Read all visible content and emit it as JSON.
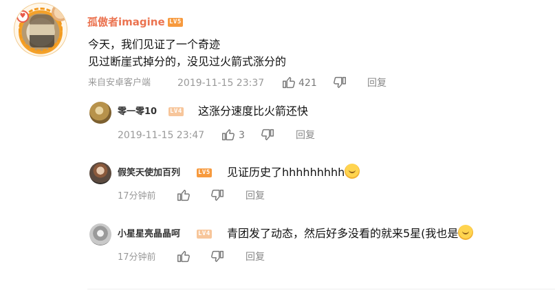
{
  "main_comment": {
    "username": "孤傲者imagine",
    "level": "LV5",
    "lines": [
      "今天，我们见证了一个奇迹",
      "见过断崖式掉分的，没见过火箭式涨分的"
    ],
    "source": "来自安卓客户端",
    "timestamp": "2019-11-15 23:37",
    "likes": "421",
    "reply_label": "回复"
  },
  "replies": [
    {
      "username": "零一零10",
      "level": "LV4",
      "text": "这涨分速度比火箭还快",
      "timestamp": "2019-11-15 23:47",
      "likes": "3",
      "reply_label": "回复"
    },
    {
      "username": "假笑天使加百列",
      "level": "LV5",
      "text": "见证历史了hhhhhhhhh",
      "timestamp": "17分钟前",
      "reply_label": "回复",
      "emoji": "laughing-crying-emoji"
    },
    {
      "username": "小星星亮晶晶呵",
      "level": "LV4",
      "text": "青团发了动态，然后好多没看的就来5星(我也是",
      "timestamp": "17分钟前",
      "reply_label": "回复",
      "emoji": "laughing-crying-emoji"
    }
  ],
  "icons": {
    "like": "thumbs-up-icon",
    "dislike": "thumbs-down-icon"
  },
  "colors": {
    "main_username": "#eb7350",
    "level_badge": "#f79a3e",
    "level_badge_faded": "#f7c69b",
    "meta_text": "#999999"
  }
}
